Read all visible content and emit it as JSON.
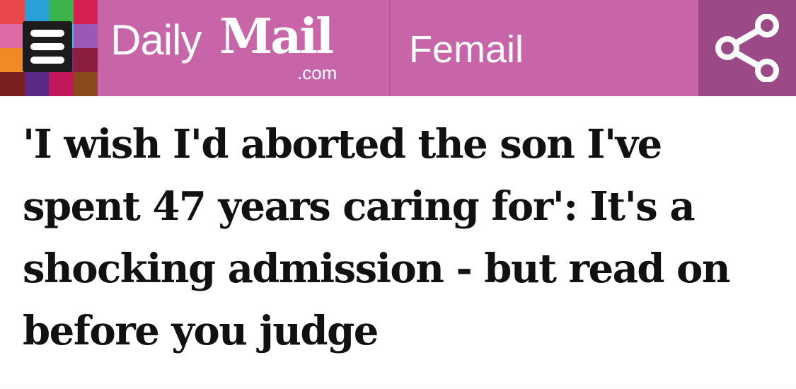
{
  "header": {
    "menu_icon": "hamburger-menu-icon",
    "brand": {
      "daily": "Daily",
      "mail": "Mail",
      "domain": ".com"
    },
    "section_label": "Femail",
    "share_icon": "share-icon",
    "colors": {
      "header_bg": "#c865a8",
      "share_bg": "#9c4a87",
      "mosaic": [
        "#e8474c",
        "#2aa0d9",
        "#3bb54a",
        "#d6204f",
        "#e06aa6",
        "#1b1b1b",
        "#31c9d6",
        "#9b59b6",
        "#f08a24",
        "#1b1b1b",
        "#6a2e8c",
        "#8b1e3f",
        "#7a1f1f",
        "#5b2a86",
        "#c2185b",
        "#8a4b1c"
      ]
    }
  },
  "article": {
    "headline": "'I wish I'd aborted the son I've spent 47 years caring for': It's a shocking admission - but read on before you judge"
  }
}
